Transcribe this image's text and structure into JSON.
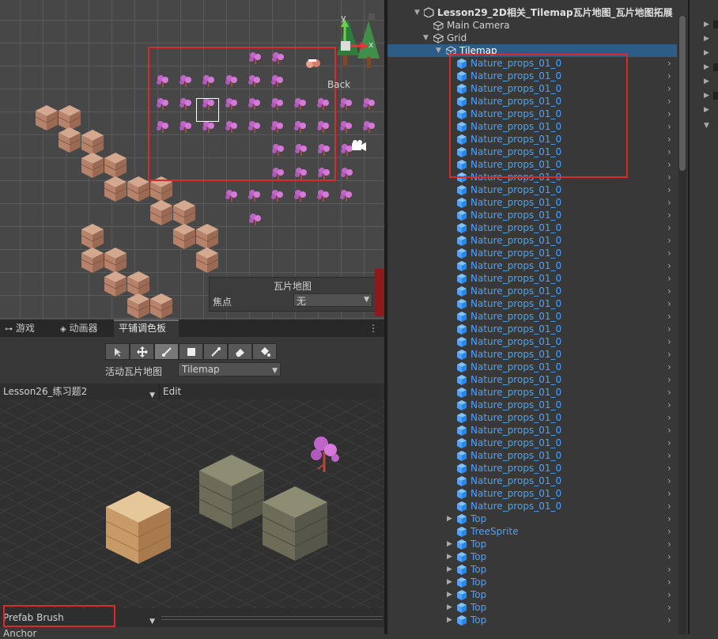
{
  "scene": {
    "back_label": "Back",
    "gizmo": {
      "y": "y",
      "x": "x"
    },
    "tilemap_overlay": {
      "title": "瓦片地图",
      "focus_label": "焦点",
      "focus_value": "无"
    }
  },
  "bottom_tabs": [
    {
      "label": "游戏",
      "icon": "gamepad-icon"
    },
    {
      "label": "动画器",
      "icon": "animator-icon"
    },
    {
      "label": "平铺调色板",
      "active": true
    }
  ],
  "palette": {
    "tools": [
      "select-tool",
      "move-tool",
      "paint-tool",
      "box-fill-tool",
      "picker-tool",
      "eraser-tool",
      "fill-tool"
    ],
    "active_tilemap_label": "活动瓦片地图",
    "active_tilemap_value": "Tilemap",
    "palette_name": "Lesson26_练习题2",
    "edit_label": "Edit",
    "brush_value": "Prefab Brush",
    "anchor_label": "Anchor"
  },
  "hierarchy": {
    "scene_title": "Lesson29_2D相关_Tilemap瓦片地图_瓦片地图拓展",
    "items": [
      {
        "label": "Main Camera",
        "depth": 1,
        "type": "gameobject",
        "fold": false
      },
      {
        "label": "Grid",
        "depth": 1,
        "type": "gameobject",
        "fold": "open"
      },
      {
        "label": "Tilemap",
        "depth": 2,
        "type": "gameobject",
        "fold": "open",
        "selected": true
      },
      {
        "label": "Nature_props_01_0",
        "depth": 3,
        "type": "prefab"
      },
      {
        "label": "Nature_props_01_0",
        "depth": 3,
        "type": "prefab"
      },
      {
        "label": "Nature_props_01_0",
        "depth": 3,
        "type": "prefab"
      },
      {
        "label": "Nature_props_01_0",
        "depth": 3,
        "type": "prefab"
      },
      {
        "label": "Nature_props_01_0",
        "depth": 3,
        "type": "prefab"
      },
      {
        "label": "Nature_props_01_0",
        "depth": 3,
        "type": "prefab"
      },
      {
        "label": "Nature_props_01_0",
        "depth": 3,
        "type": "prefab"
      },
      {
        "label": "Nature_props_01_0",
        "depth": 3,
        "type": "prefab"
      },
      {
        "label": "Nature_props_01_0",
        "depth": 3,
        "type": "prefab"
      },
      {
        "label": "Nature_props_01_0",
        "depth": 3,
        "type": "prefab"
      },
      {
        "label": "Nature_props_01_0",
        "depth": 3,
        "type": "prefab"
      },
      {
        "label": "Nature_props_01_0",
        "depth": 3,
        "type": "prefab"
      },
      {
        "label": "Nature_props_01_0",
        "depth": 3,
        "type": "prefab"
      },
      {
        "label": "Nature_props_01_0",
        "depth": 3,
        "type": "prefab"
      },
      {
        "label": "Nature_props_01_0",
        "depth": 3,
        "type": "prefab"
      },
      {
        "label": "Nature_props_01_0",
        "depth": 3,
        "type": "prefab"
      },
      {
        "label": "Nature_props_01_0",
        "depth": 3,
        "type": "prefab"
      },
      {
        "label": "Nature_props_01_0",
        "depth": 3,
        "type": "prefab"
      },
      {
        "label": "Nature_props_01_0",
        "depth": 3,
        "type": "prefab"
      },
      {
        "label": "Nature_props_01_0",
        "depth": 3,
        "type": "prefab"
      },
      {
        "label": "Nature_props_01_0",
        "depth": 3,
        "type": "prefab"
      },
      {
        "label": "Nature_props_01_0",
        "depth": 3,
        "type": "prefab"
      },
      {
        "label": "Nature_props_01_0",
        "depth": 3,
        "type": "prefab"
      },
      {
        "label": "Nature_props_01_0",
        "depth": 3,
        "type": "prefab"
      },
      {
        "label": "Nature_props_01_0",
        "depth": 3,
        "type": "prefab"
      },
      {
        "label": "Nature_props_01_0",
        "depth": 3,
        "type": "prefab"
      },
      {
        "label": "Nature_props_01_0",
        "depth": 3,
        "type": "prefab"
      },
      {
        "label": "Nature_props_01_0",
        "depth": 3,
        "type": "prefab"
      },
      {
        "label": "Nature_props_01_0",
        "depth": 3,
        "type": "prefab"
      },
      {
        "label": "Nature_props_01_0",
        "depth": 3,
        "type": "prefab"
      },
      {
        "label": "Nature_props_01_0",
        "depth": 3,
        "type": "prefab"
      },
      {
        "label": "Nature_props_01_0",
        "depth": 3,
        "type": "prefab"
      },
      {
        "label": "Nature_props_01_0",
        "depth": 3,
        "type": "prefab"
      },
      {
        "label": "Nature_props_01_0",
        "depth": 3,
        "type": "prefab"
      },
      {
        "label": "Nature_props_01_0",
        "depth": 3,
        "type": "prefab"
      },
      {
        "label": "Nature_props_01_0",
        "depth": 3,
        "type": "prefab"
      },
      {
        "label": "Top",
        "depth": 3,
        "type": "prefab",
        "fold": true
      },
      {
        "label": "TreeSprite",
        "depth": 3,
        "type": "prefab"
      },
      {
        "label": "Top",
        "depth": 3,
        "type": "prefab",
        "fold": true
      },
      {
        "label": "Top",
        "depth": 3,
        "type": "prefab",
        "fold": true
      },
      {
        "label": "Top",
        "depth": 3,
        "type": "prefab",
        "fold": true
      },
      {
        "label": "Top",
        "depth": 3,
        "type": "prefab",
        "fold": true
      },
      {
        "label": "Top",
        "depth": 3,
        "type": "prefab",
        "fold": true
      },
      {
        "label": "Top",
        "depth": 3,
        "type": "prefab",
        "fold": true
      },
      {
        "label": "Top",
        "depth": 3,
        "type": "prefab",
        "fold": true
      }
    ]
  },
  "colors": {
    "prefab_text": "#4aa3ff",
    "selection": "#2c5d87",
    "highlight_box": "#d92b2b"
  }
}
